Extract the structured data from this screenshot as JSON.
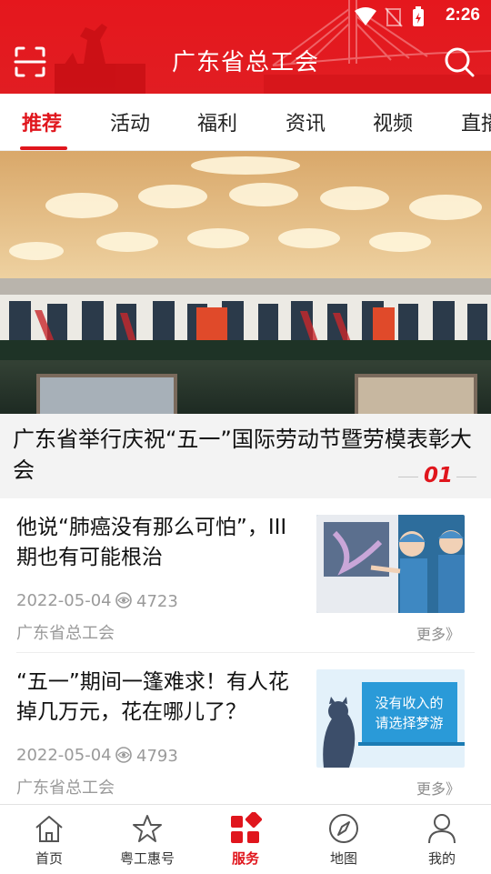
{
  "status_bar": {
    "time": "2:26"
  },
  "header": {
    "title": "广东省总工会"
  },
  "tabs": [
    {
      "label": "推荐"
    },
    {
      "label": "活动"
    },
    {
      "label": "福利"
    },
    {
      "label": "资讯"
    },
    {
      "label": "视频"
    },
    {
      "label": "直播"
    }
  ],
  "hero": {
    "caption": "广东省举行庆祝“五一”国际劳动节暨劳模表彰大会",
    "index": "01"
  },
  "news": [
    {
      "title": "他说“肺癌没有那么可怕”，III期也有可能根治",
      "date": "2022-05-04",
      "views": "4723",
      "source": "广东省总工会",
      "more": "更多》"
    },
    {
      "title": "“五一”期间一篷难求！有人花掉几万元，花在哪儿了？",
      "date": "2022-05-04",
      "views": "4793",
      "source": "广东省总工会",
      "more": "更多》",
      "thumb_text": "没有收入的请选择梦游"
    }
  ],
  "bottom_nav": [
    {
      "label": "首页",
      "icon": "home-icon"
    },
    {
      "label": "粤工惠号",
      "icon": "star-icon"
    },
    {
      "label": "服务",
      "icon": "services-icon"
    },
    {
      "label": "地图",
      "icon": "compass-icon"
    },
    {
      "label": "我的",
      "icon": "user-icon"
    }
  ],
  "colors": {
    "brand_red": "#e0161d",
    "header_red": "#e5171d"
  }
}
